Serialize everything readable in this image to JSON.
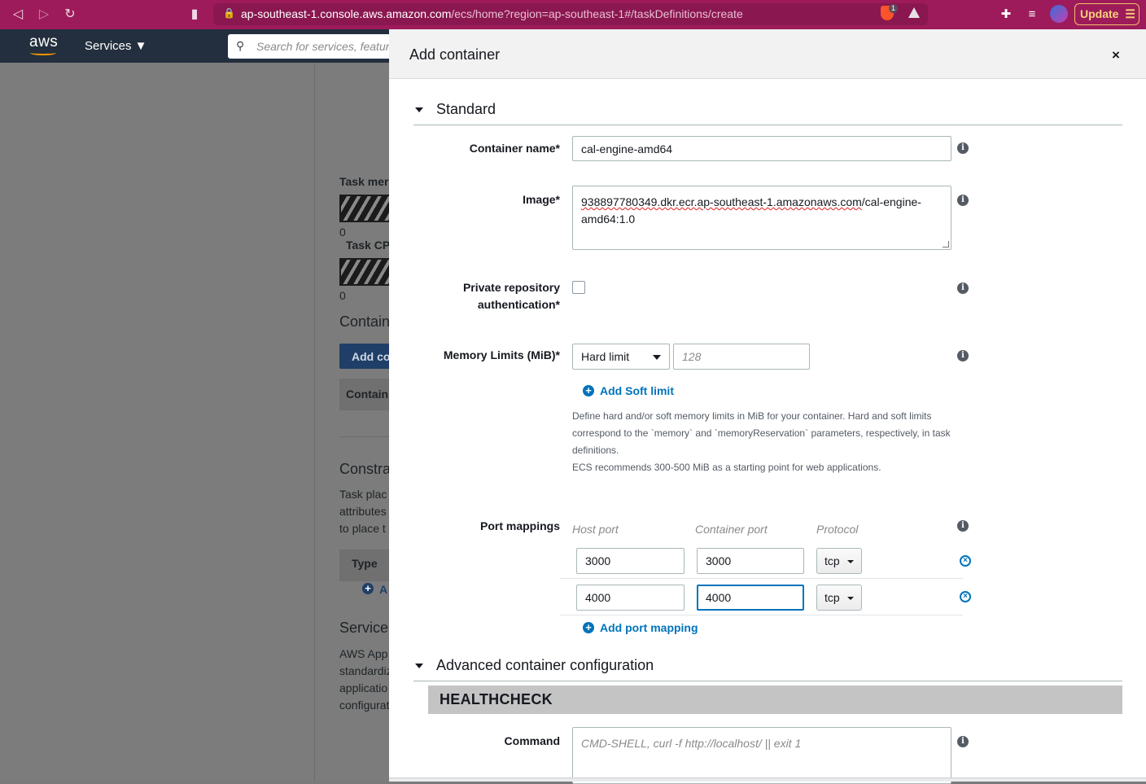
{
  "browser": {
    "url_host": "ap-southeast-1.console.aws.amazon.com",
    "url_path": "/ecs/home?region=ap-southeast-1#/taskDefinitions/create",
    "brave_badge": "1",
    "update_label": "Update"
  },
  "aws_nav": {
    "logo": "aws",
    "services_label": "Services ▼",
    "search_placeholder": "Search for services, features"
  },
  "background_page": {
    "task_memory_label": "Task mer",
    "task_memory_value": "0",
    "task_cpu_label": "Task CP",
    "task_cpu_value": "0",
    "containers_heading": "Contain",
    "add_container_button": "Add co",
    "containers_column": "Contain",
    "constraints_heading": "Constra",
    "constraints_lines": [
      "Task plac",
      "attributes",
      "to place t"
    ],
    "type_column": "Type",
    "add_link": "A",
    "service_heading": "Service",
    "service_lines": [
      "AWS App",
      "standardiz",
      "applicatio",
      "configurat"
    ]
  },
  "modal": {
    "title": "Add container",
    "close_icon": "×",
    "standard_section": "Standard",
    "container_name_label": "Container name*",
    "container_name_value": "cal-engine-amd64",
    "image_label": "Image*",
    "image_value_part1": "938897780349.dkr.ecr.ap-southeast-1.amazonaws.com",
    "image_value_part2": "/cal-engine-",
    "image_value_part3": "amd64:1.0",
    "private_repo_label_line1": "Private repository",
    "private_repo_label_line2": "authentication*",
    "memory_label": "Memory Limits (MiB)*",
    "memory_select": "Hard limit",
    "memory_placeholder": "128",
    "add_soft_limit": "Add Soft limit",
    "memory_help": [
      "Define hard and/or soft memory limits in MiB for your container. Hard and soft limits",
      "correspond to the `memory` and `memoryReservation` parameters, respectively, in task",
      "definitions.",
      "ECS recommends 300-500 MiB as a starting point for web applications."
    ],
    "port_mappings_label": "Port mappings",
    "port_columns": [
      "Host port",
      "Container port",
      "Protocol"
    ],
    "port_rows": [
      {
        "host": "3000",
        "container": "3000",
        "protocol": "tcp"
      },
      {
        "host": "4000",
        "container": "4000",
        "protocol": "tcp"
      }
    ],
    "add_port_mapping": "Add port mapping",
    "advanced_section": "Advanced container configuration",
    "healthcheck_title": "HEALTHCHECK",
    "command_label": "Command",
    "command_placeholder": "CMD-SHELL, curl -f http://localhost/ || exit 1"
  },
  "colors": {
    "browser_bar": "#9d1b5a",
    "aws_nav": "#232f3e",
    "link_blue": "#0073bb",
    "healthcheck_bar": "#c4c4c4"
  }
}
